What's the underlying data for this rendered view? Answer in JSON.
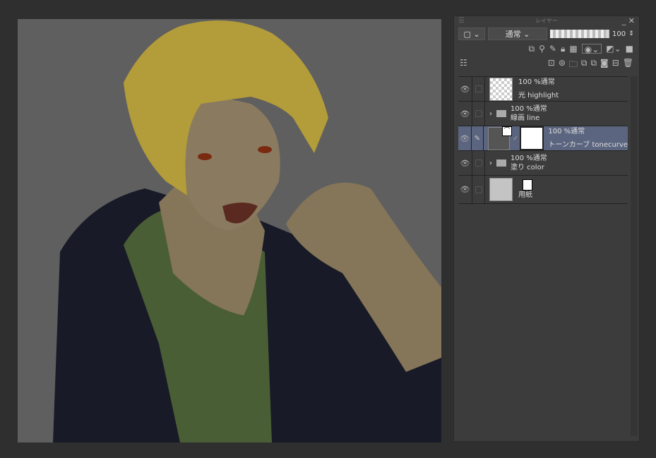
{
  "panel": {
    "title": "レイヤー",
    "blend_mode": "通常",
    "opacity": "100"
  },
  "layers": [
    {
      "name": "光 highlight",
      "mode": "100 %通常",
      "type": "raster"
    },
    {
      "name": "線画 line",
      "mode": "100 %通常",
      "type": "folder"
    },
    {
      "name": "トーンカーブ tonecurve",
      "mode": "100 %通常",
      "type": "correction",
      "selected": true
    },
    {
      "name": "塗り color",
      "mode": "100 %通常",
      "type": "folder"
    },
    {
      "name": "用紙",
      "mode": "",
      "type": "paper"
    }
  ],
  "colors": {
    "canvas_bg": "#5f5f5f",
    "panel_bg": "#3c3c3c",
    "selected": "#5b6580",
    "hair": "#b9a03a",
    "skin": "#8a7a60",
    "shirt": "#4a5e35",
    "jacket": "#181b27"
  }
}
